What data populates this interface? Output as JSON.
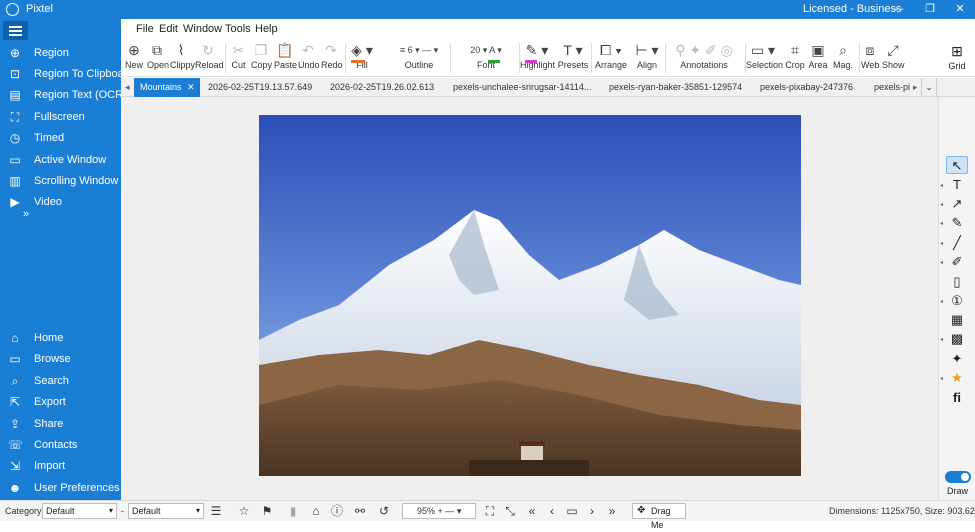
{
  "app": {
    "title": "Pixtel",
    "license": "Licensed - Business"
  },
  "menu": [
    "File",
    "Edit",
    "Window",
    "Tools",
    "Help"
  ],
  "sidebar": {
    "capture": [
      {
        "label": "Region",
        "icon": "crosshair-icon"
      },
      {
        "label": "Region To Clipboard",
        "icon": "clipboard-region-icon"
      },
      {
        "label": "Region Text (OCR)",
        "icon": "ocr-text-icon"
      },
      {
        "label": "Fullscreen",
        "icon": "fullscreen-icon"
      },
      {
        "label": "Timed",
        "icon": "timer-icon"
      },
      {
        "label": "Active Window",
        "icon": "window-icon"
      },
      {
        "label": "Scrolling Window",
        "icon": "scrolling-window-icon"
      },
      {
        "label": "Video",
        "icon": "video-camera-icon"
      }
    ],
    "more": "»",
    "nav": [
      {
        "label": "Home",
        "icon": "home-icon"
      },
      {
        "label": "Browse",
        "icon": "folder-icon"
      },
      {
        "label": "Search",
        "icon": "search-icon"
      },
      {
        "label": "Export",
        "icon": "export-icon"
      },
      {
        "label": "Share",
        "icon": "share-icon"
      },
      {
        "label": "Contacts",
        "icon": "contacts-icon"
      },
      {
        "label": "Import",
        "icon": "import-icon"
      },
      {
        "label": "User Preferences",
        "icon": "user-icon"
      }
    ]
  },
  "ribbon": {
    "new": "New",
    "open": "Open",
    "clippy": "Clippy",
    "reload": "Reload",
    "cut": "Cut",
    "copy": "Copy",
    "paste": "Paste",
    "undo": "Undo",
    "redo": "Redo",
    "fill": "Fill",
    "outline": "Outline",
    "outline_width": "6",
    "font": "Font",
    "font_size": "20",
    "highlight": "Highlight",
    "presets": "Presets",
    "arrange": "Arrange",
    "align": "Align",
    "annotations": "Annotations",
    "selection": "Selection",
    "crop": "Crop",
    "area": "Area",
    "mag": "Mag.",
    "web": "Web",
    "show": "Show",
    "grid": "Grid",
    "fill_color": "#e8702a",
    "font_color": "#2e9e3a",
    "highlight_color": "#d63ad6"
  },
  "tabs": [
    {
      "label": "Mountains",
      "active": true
    },
    {
      "label": "2026-02-25T19.13.57.649"
    },
    {
      "label": "2026-02-25T19.26.02.613"
    },
    {
      "label": "pexels-unchalee-srirugsar-14114..."
    },
    {
      "label": "pexels-ryan-baker-35851-129574"
    },
    {
      "label": "pexels-pixabay-247376"
    },
    {
      "label": "pexels-pi"
    }
  ],
  "tools": [
    "pointer-icon",
    "text-tool-icon",
    "arrow-tool-icon",
    "pen-icon",
    "line-icon",
    "marker-icon",
    "note-icon",
    "step-counter-icon",
    "sticker-icon",
    "blur-icon",
    "magic-icon",
    "star-icon",
    "font-effect-icon"
  ],
  "draw_toggle": "Draw",
  "status": {
    "category_label": "Category",
    "category_value": "Default",
    "sep": "-",
    "preset_value": "Default",
    "zoom": "95%",
    "drag_me": "Drag Me",
    "dimensions": "Dimensions: 1125x750, Size: 903.62 KB"
  }
}
